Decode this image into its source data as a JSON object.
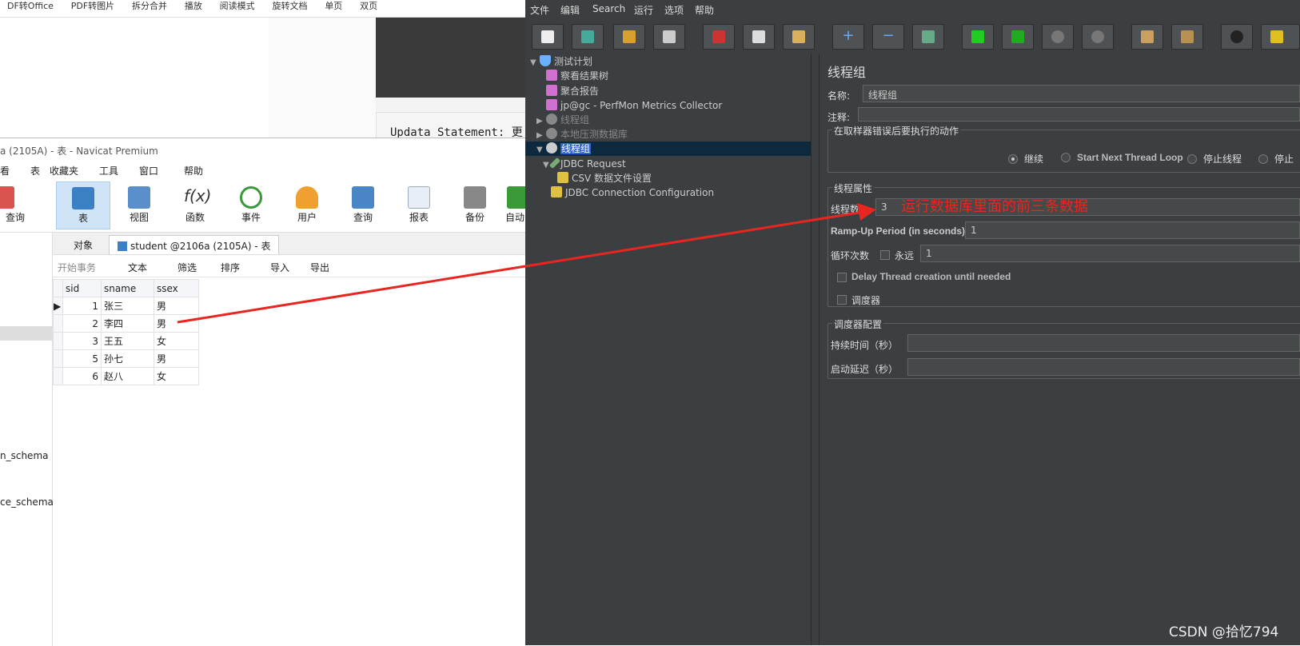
{
  "bg": {
    "toolbar": [
      "DF转Office",
      "PDF转图片",
      "拆分合并",
      "播放",
      "阅读模式",
      "旋转文档",
      "单页",
      "双页"
    ],
    "code": "Updata Statement: 更"
  },
  "navicat": {
    "title": "a (2105A) - 表 - Navicat Premium",
    "menu": [
      "看",
      "表",
      "收藏夹",
      "工具",
      "窗口",
      "帮助"
    ],
    "tools": [
      "查询",
      "表",
      "视图",
      "函数",
      "事件",
      "用户",
      "查询",
      "报表",
      "备份",
      "自动"
    ],
    "tab_object": "对象",
    "tab_table": "student @2106a (2105A) - 表",
    "sub": [
      "开始事务",
      "文本",
      "筛选",
      "排序",
      "导入",
      "导出"
    ],
    "columns": [
      "sid",
      "sname",
      "ssex"
    ],
    "rows": [
      [
        "1",
        "张三",
        "男"
      ],
      [
        "2",
        "李四",
        "男"
      ],
      [
        "3",
        "王五",
        "女"
      ],
      [
        "5",
        "孙七",
        "男"
      ],
      [
        "6",
        "赵八",
        "女"
      ]
    ],
    "left_items": [
      "n_schema",
      "ce_schema"
    ]
  },
  "jmeter": {
    "menu": [
      "文件",
      "编辑",
      "Search",
      "运行",
      "选项",
      "帮助"
    ],
    "tree": [
      "测试计划",
      "察看结果树",
      "聚合报告",
      "jp@gc - PerfMon Metrics Collector",
      "线程组",
      "本地压测数据库",
      "线程组",
      "JDBC Request",
      "CSV 数据文件设置",
      "JDBC Connection Configuration"
    ],
    "panel": {
      "title": "线程组",
      "name_label": "名称:",
      "name_value": "线程组",
      "comment_label": "注释:",
      "error_group": "在取样器错误后要执行的动作",
      "actions": [
        "继续",
        "Start Next Thread Loop",
        "停止线程",
        "停止"
      ],
      "props_group": "线程属性",
      "threads_label": "线程数:",
      "threads_value": "3",
      "rampup_label": "Ramp-Up Period (in seconds):",
      "rampup_value": "1",
      "loop_label": "循环次数",
      "forever_label": "永远",
      "loop_value": "1",
      "delay_label": "Delay Thread creation until needed",
      "scheduler_label": "调度器",
      "sched_group": "调度器配置",
      "duration_label": "持续时间（秒）",
      "startdelay_label": "启动延迟（秒）"
    }
  },
  "annotation": "运行数据库里面的前三条数据",
  "watermark": "CSDN @拾忆794",
  "colors": {
    "arrow": "#e8261f",
    "jmeter_bg": "#3c3f41",
    "tree_selected": "#0d293e"
  }
}
